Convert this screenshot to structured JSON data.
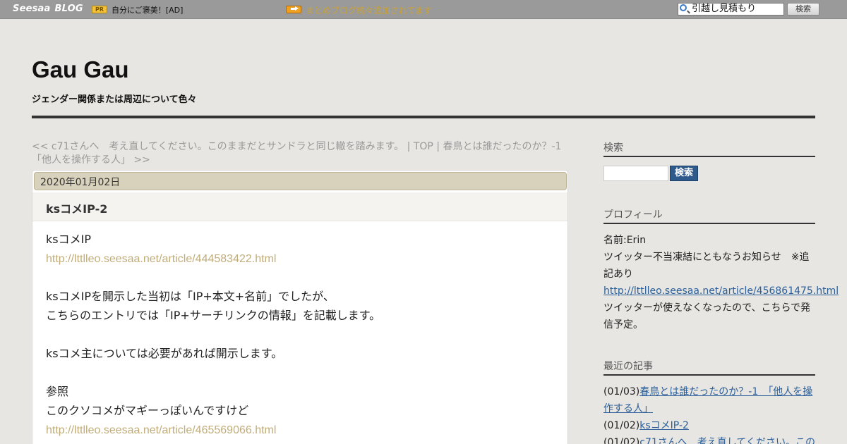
{
  "topbar": {
    "logo_seesaa": "Seesaa",
    "logo_blog": "BLOG",
    "pr_badge": "PR",
    "ad_text": "自分にご褒美！[AD]",
    "notice": "まとめブログ続々追加されてます",
    "search_value": "引越し見積もり",
    "search_button": "検索"
  },
  "header": {
    "title": "Gau Gau",
    "description": "ジェンダー関係または周辺について色々"
  },
  "nav": {
    "prev": "<< c71さんへ　考え直してください。このままだとサンドラと同じ轍を踏みます。",
    "sep1": " | ",
    "top": "TOP",
    "sep2": " | ",
    "next_line1": "春鳥とは誰だったのか？-1",
    "next_line2": "「他人を操作する人」 >>"
  },
  "entry": {
    "date": "2020年01月02日",
    "title": "ksコメIP-2",
    "lines": [
      {
        "text": "ksコメIP"
      },
      {
        "link": "http://lttlleo.seesaa.net/article/444583422.html"
      },
      {
        "text": ""
      },
      {
        "text": "ksコメIPを開示した当初は「IP+本文+名前」でしたが、"
      },
      {
        "text": "こちらのエントリでは「IP+サーチリンクの情報」を記載します。"
      },
      {
        "text": ""
      },
      {
        "text": "ksコメ主については必要があれば開示します。"
      },
      {
        "text": ""
      },
      {
        "text": "参照"
      },
      {
        "text": "このクソコメがマギーっぽいんですけど"
      },
      {
        "link": "http://lttlleo.seesaa.net/article/465569066.html"
      }
    ]
  },
  "sidebar": {
    "search_heading": "検索",
    "search_button": "検索",
    "profile_heading": "プロフィール",
    "profile_name": "名前:Erin",
    "profile_notice_1": "ツイッター不当凍結にともなうお知らせ　※追",
    "profile_notice_2": "記あり",
    "profile_link": "http://lttlleo.seesaa.net/article/456861475.html",
    "profile_text_1": "ツイッターが使えなくなったので、こちらで発",
    "profile_text_2": "信予定。",
    "recent_heading": "最近の記事",
    "recent": [
      {
        "date": "(01/03)",
        "title_1": "春鳥とは誰だったのか？-1　「他人を操",
        "title_2": "作する人」"
      },
      {
        "date": "(01/02)",
        "title_1": "ksコメIP-2",
        "title_2": ""
      },
      {
        "date": "(01/02)",
        "title_1": "c71さんへ　考え直してください。この",
        "title_2": ""
      }
    ]
  }
}
